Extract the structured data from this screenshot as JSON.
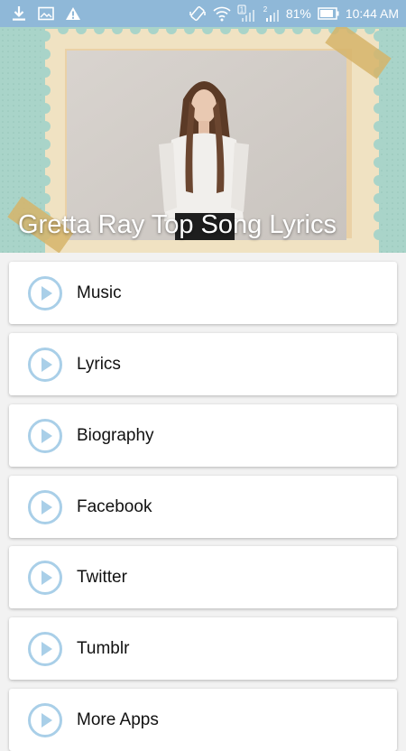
{
  "status_bar": {
    "battery": "81%",
    "time": "10:44 AM",
    "icons": [
      "download-icon",
      "image-icon",
      "warning-icon",
      "vibrate-icon",
      "wifi-icon",
      "signal-1-icon",
      "signal-2-icon",
      "battery-icon"
    ],
    "sim_labels": [
      "1",
      "2"
    ]
  },
  "header": {
    "title": "Gretta Ray Top Song Lyrics"
  },
  "menu": {
    "items": [
      {
        "label": "Music"
      },
      {
        "label": "Lyrics"
      },
      {
        "label": "Biography"
      },
      {
        "label": "Facebook"
      },
      {
        "label": "Twitter"
      },
      {
        "label": "Tumblr"
      },
      {
        "label": "More Apps"
      }
    ]
  },
  "colors": {
    "status_bar": "#8fb8d8",
    "header_bg": "#a9d4c9",
    "play_icon": "#a9cfe8",
    "card_bg": "#ffffff",
    "page_bg": "#f2f2f2"
  }
}
